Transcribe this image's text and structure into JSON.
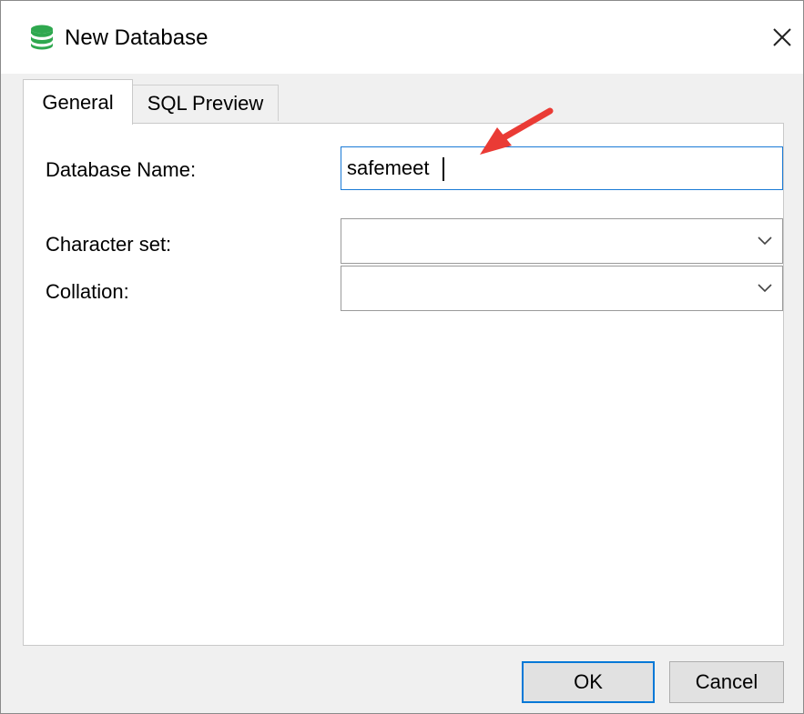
{
  "window": {
    "title": "New Database",
    "title_icon": "database-icon",
    "close_icon": "close-icon",
    "icon_color": "#2fa84f"
  },
  "tabs": [
    {
      "label": "General",
      "active": true
    },
    {
      "label": "SQL Preview",
      "active": false
    }
  ],
  "form": {
    "database_name_label": "Database Name:",
    "database_name_value": "safemeet",
    "character_set_label": "Character set:",
    "character_set_value": "",
    "collation_label": "Collation:",
    "collation_value": ""
  },
  "buttons": {
    "ok_label": "OK",
    "cancel_label": "Cancel"
  },
  "annotation": {
    "arrow_color": "#ea3b35"
  }
}
